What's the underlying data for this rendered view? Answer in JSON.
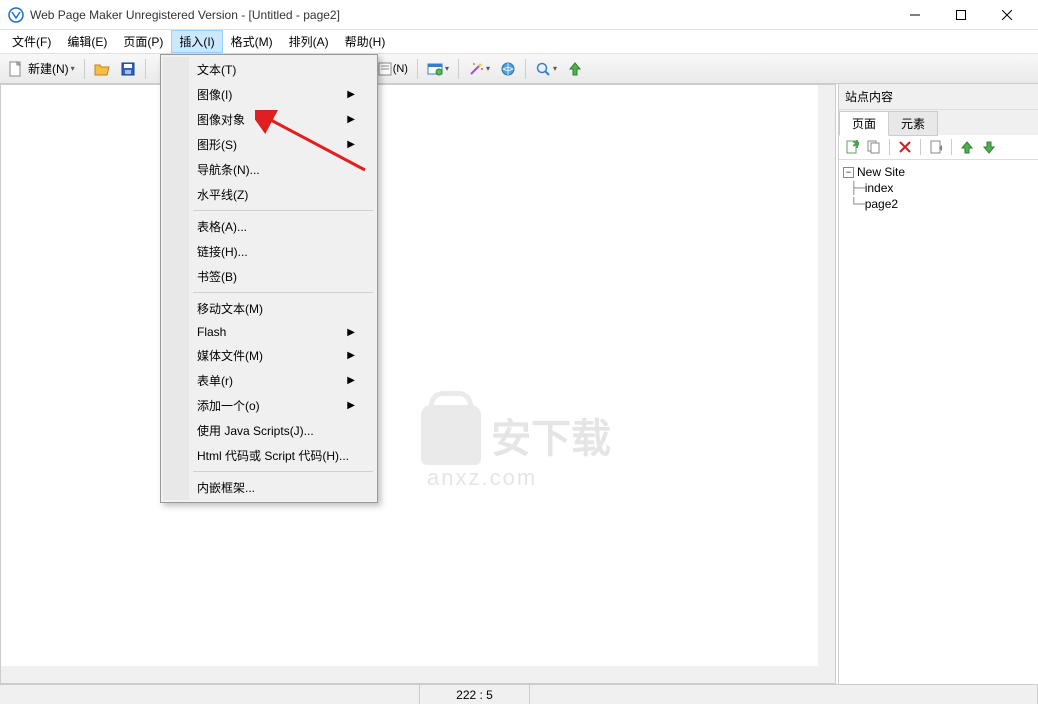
{
  "titlebar": {
    "title": "Web Page Maker Unregistered Version - [Untitled - page2]"
  },
  "menubar": {
    "file": "文件(F)",
    "edit": "编辑(E)",
    "page": "页面(P)",
    "insert": "插入(I)",
    "format": "格式(M)",
    "arrange": "排列(A)",
    "help": "帮助(H)"
  },
  "toolbar": {
    "new_label": "新建(N)"
  },
  "dropdown": {
    "text": "文本(T)",
    "image": "图像(I)",
    "image_obj": "图像对象",
    "shape": "图形(S)",
    "navbar": "导航条(N)...",
    "hr": "水平线(Z)",
    "table": "表格(A)...",
    "link": "链接(H)...",
    "bookmark": "书签(B)",
    "marquee": "移动文本(M)",
    "flash": "Flash",
    "media": "媒体文件(M)",
    "form": "表单(r)",
    "addone": "添加一个(o)",
    "js": "使用 Java Scripts(J)...",
    "html": "Html 代码或 Script 代码(H)...",
    "iframe": "内嵌框架..."
  },
  "sidebar": {
    "title": "站点内容",
    "tab_page": "页面",
    "tab_element": "元素",
    "tree": {
      "root": "New Site",
      "children": [
        "index",
        "page2"
      ]
    }
  },
  "statusbar": {
    "coords": "222 : 5"
  },
  "watermark": {
    "text1": "安下载",
    "text2": "anxz.com"
  }
}
